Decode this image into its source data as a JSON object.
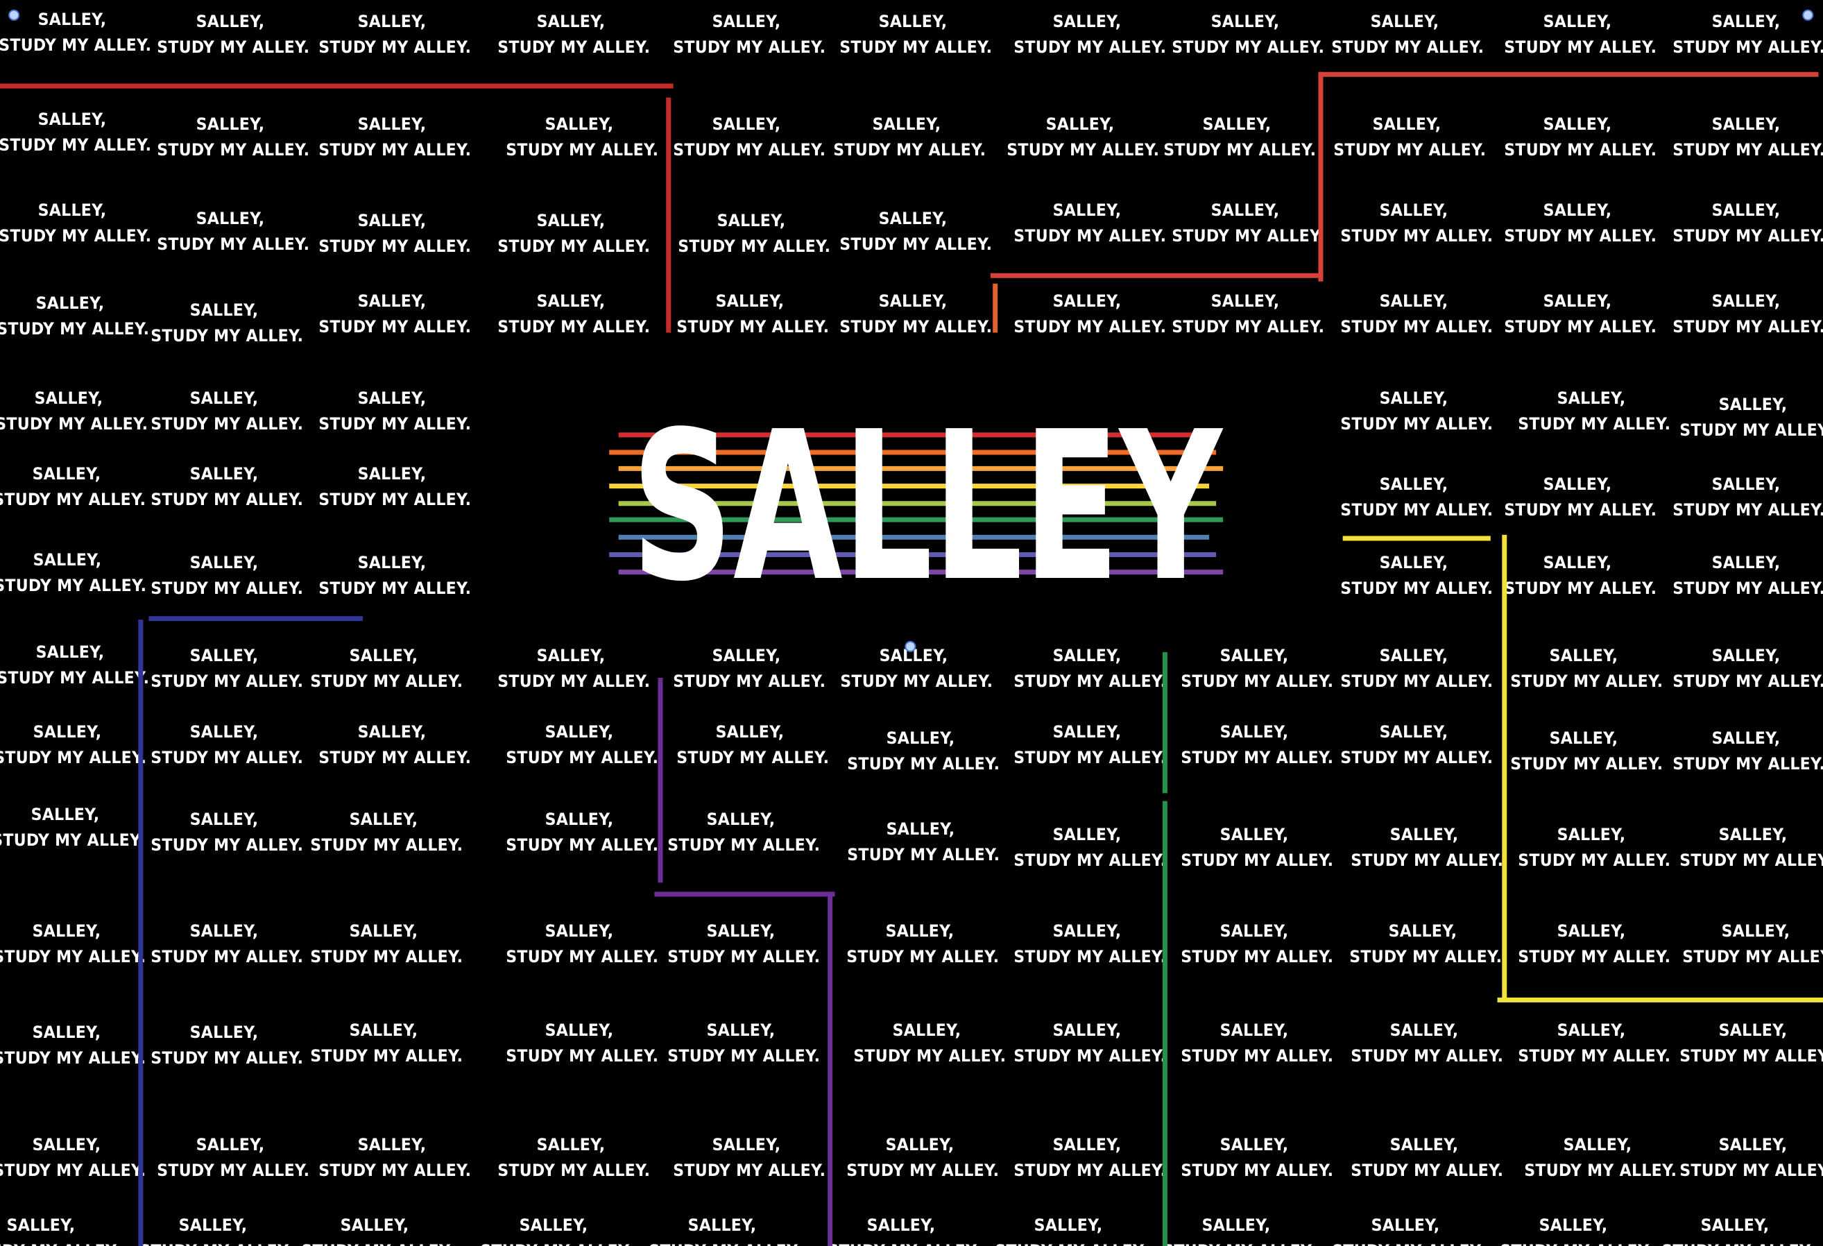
{
  "logo": {
    "text": "SALLEY",
    "color": "#ffffff",
    "stripe_colors": [
      "#d32f2f",
      "#ef6c28",
      "#f7a23b",
      "#f8d53a",
      "#a7c94a",
      "#2e9a58",
      "#4f7fb0",
      "#5f5bb0",
      "#7e46a8"
    ]
  },
  "tile_text": {
    "line1": "SALLEY,",
    "line2": "STUDY MY ALLEY."
  },
  "colors": {
    "background": "#000000",
    "text": "#ffffff",
    "red": "#c42a2a",
    "red_light": "#d6423a",
    "orange": "#e0622e",
    "yellow": "#f2e13a",
    "green": "#23954a",
    "blue": "#30359a",
    "purple": "#6a2e96",
    "marker": "#bcd4ff"
  }
}
